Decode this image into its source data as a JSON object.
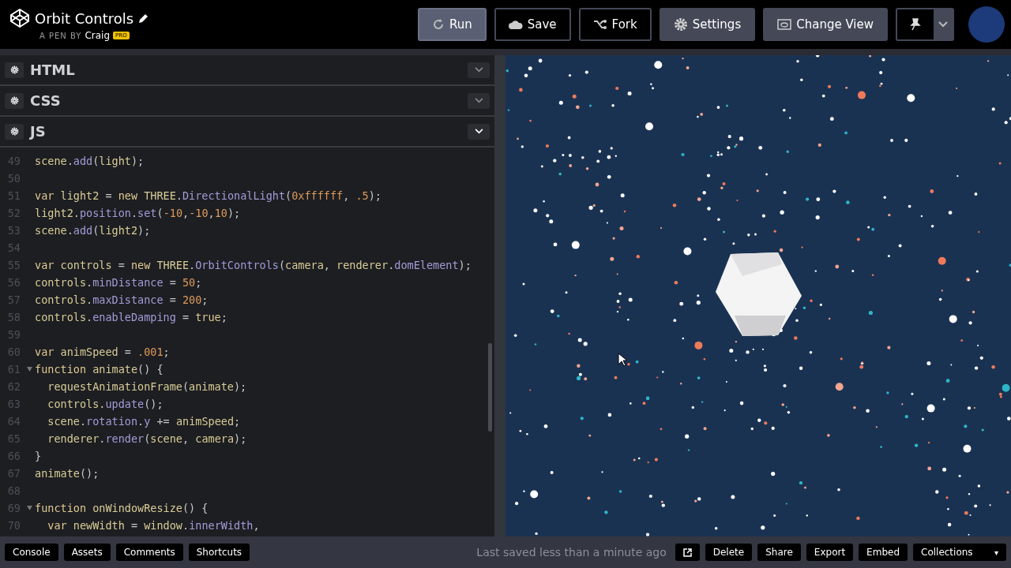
{
  "header": {
    "title": "Orbit Controls",
    "byline": "A PEN BY",
    "author": "Craig",
    "badge": "PRO",
    "buttons": [
      {
        "label": "Run",
        "kind": "run"
      },
      {
        "label": "Save",
        "kind": "save"
      },
      {
        "label": "Fork",
        "kind": "fork"
      },
      {
        "label": "Settings",
        "kind": "settings"
      },
      {
        "label": "Change View",
        "kind": "view"
      }
    ]
  },
  "panels": [
    {
      "label": "HTML",
      "expanded": false
    },
    {
      "label": "CSS",
      "expanded": false
    },
    {
      "label": "JS",
      "expanded": true
    }
  ],
  "code": [
    {
      "n": "49",
      "fold": false,
      "tokens": [
        {
          "kind": "ident",
          "text": "scene"
        },
        {
          "kind": "punct",
          "text": "."
        },
        {
          "kind": "member",
          "text": "add"
        },
        {
          "kind": "punct",
          "text": "("
        },
        {
          "kind": "ident",
          "text": "light"
        },
        {
          "kind": "punct",
          "text": ");"
        }
      ]
    },
    {
      "n": "50",
      "fold": false
    },
    {
      "n": "51",
      "fold": false,
      "tokens": [
        {
          "kind": "keyword",
          "text": "var "
        },
        {
          "kind": "ident",
          "text": "light2"
        },
        {
          "kind": "punct",
          "text": " = "
        },
        {
          "kind": "keyword",
          "text": "new "
        },
        {
          "kind": "ident",
          "text": "THREE"
        },
        {
          "kind": "punct",
          "text": "."
        },
        {
          "kind": "member",
          "text": "DirectionalLight"
        },
        {
          "kind": "punct",
          "text": "("
        },
        {
          "kind": "number",
          "text": "0xffffff"
        },
        {
          "kind": "punct",
          "text": ", "
        },
        {
          "kind": "number",
          "text": ".5"
        },
        {
          "kind": "punct",
          "text": ");"
        }
      ]
    },
    {
      "n": "52",
      "fold": false,
      "tokens": [
        {
          "kind": "ident",
          "text": "light2"
        },
        {
          "kind": "punct",
          "text": "."
        },
        {
          "kind": "member",
          "text": "position"
        },
        {
          "kind": "punct",
          "text": "."
        },
        {
          "kind": "member",
          "text": "set"
        },
        {
          "kind": "punct",
          "text": "("
        },
        {
          "kind": "number",
          "text": "-10"
        },
        {
          "kind": "punct",
          "text": ","
        },
        {
          "kind": "number",
          "text": "-10"
        },
        {
          "kind": "punct",
          "text": ","
        },
        {
          "kind": "number",
          "text": "10"
        },
        {
          "kind": "punct",
          "text": ");"
        }
      ]
    },
    {
      "n": "53",
      "fold": false,
      "tokens": [
        {
          "kind": "ident",
          "text": "scene"
        },
        {
          "kind": "punct",
          "text": "."
        },
        {
          "kind": "member",
          "text": "add"
        },
        {
          "kind": "punct",
          "text": "("
        },
        {
          "kind": "ident",
          "text": "light2"
        },
        {
          "kind": "punct",
          "text": ");"
        }
      ]
    },
    {
      "n": "54",
      "fold": false
    },
    {
      "n": "55",
      "fold": false,
      "tokens": [
        {
          "kind": "keyword",
          "text": "var "
        },
        {
          "kind": "ident",
          "text": "controls"
        },
        {
          "kind": "punct",
          "text": " = "
        },
        {
          "kind": "keyword",
          "text": "new "
        },
        {
          "kind": "ident",
          "text": "THREE"
        },
        {
          "kind": "punct",
          "text": "."
        },
        {
          "kind": "member",
          "text": "OrbitControls"
        },
        {
          "kind": "punct",
          "text": "("
        },
        {
          "kind": "ident",
          "text": "camera"
        },
        {
          "kind": "punct",
          "text": ", "
        },
        {
          "kind": "ident",
          "text": "renderer"
        },
        {
          "kind": "punct",
          "text": "."
        },
        {
          "kind": "member",
          "text": "domElement"
        },
        {
          "kind": "punct",
          "text": ");"
        }
      ]
    },
    {
      "n": "56",
      "fold": false,
      "tokens": [
        {
          "kind": "ident",
          "text": "controls"
        },
        {
          "kind": "punct",
          "text": "."
        },
        {
          "kind": "member",
          "text": "minDistance"
        },
        {
          "kind": "punct",
          "text": " = "
        },
        {
          "kind": "number",
          "text": "50"
        },
        {
          "kind": "punct",
          "text": ";"
        }
      ]
    },
    {
      "n": "57",
      "fold": false,
      "tokens": [
        {
          "kind": "ident",
          "text": "controls"
        },
        {
          "kind": "punct",
          "text": "."
        },
        {
          "kind": "member",
          "text": "maxDistance"
        },
        {
          "kind": "punct",
          "text": " = "
        },
        {
          "kind": "number",
          "text": "200"
        },
        {
          "kind": "punct",
          "text": ";"
        }
      ]
    },
    {
      "n": "58",
      "fold": false,
      "tokens": [
        {
          "kind": "ident",
          "text": "controls"
        },
        {
          "kind": "punct",
          "text": "."
        },
        {
          "kind": "member",
          "text": "enableDamping"
        },
        {
          "kind": "punct",
          "text": " = "
        },
        {
          "kind": "keyword",
          "text": "true"
        },
        {
          "kind": "punct",
          "text": ";"
        }
      ]
    },
    {
      "n": "59",
      "fold": false
    },
    {
      "n": "60",
      "fold": false,
      "tokens": [
        {
          "kind": "keyword",
          "text": "var "
        },
        {
          "kind": "ident",
          "text": "animSpeed"
        },
        {
          "kind": "punct",
          "text": " = "
        },
        {
          "kind": "number",
          "text": ".001"
        },
        {
          "kind": "punct",
          "text": ";"
        }
      ]
    },
    {
      "n": "61",
      "fold": true,
      "tokens": [
        {
          "kind": "keyword",
          "text": "function "
        },
        {
          "kind": "ident",
          "text": "animate"
        },
        {
          "kind": "punct",
          "text": "() {"
        }
      ]
    },
    {
      "n": "62",
      "fold": false,
      "tokens": [
        {
          "kind": "ident",
          "text": "  requestAnimationFrame"
        },
        {
          "kind": "punct",
          "text": "("
        },
        {
          "kind": "ident",
          "text": "animate"
        },
        {
          "kind": "punct",
          "text": ");"
        }
      ]
    },
    {
      "n": "63",
      "fold": false,
      "tokens": [
        {
          "kind": "ident",
          "text": "  controls."
        },
        {
          "kind": "member",
          "text": "update"
        },
        {
          "kind": "punct",
          "text": "();"
        }
      ]
    },
    {
      "n": "64",
      "fold": false,
      "tokens": [
        {
          "kind": "ident",
          "text": "  scene"
        },
        {
          "kind": "punct",
          "text": "."
        },
        {
          "kind": "member",
          "text": "rotation"
        },
        {
          "kind": "punct",
          "text": "."
        },
        {
          "kind": "member",
          "text": "y"
        },
        {
          "kind": "punct",
          "text": " += "
        },
        {
          "kind": "ident",
          "text": "animSpeed"
        },
        {
          "kind": "punct",
          "text": ";"
        }
      ]
    },
    {
      "n": "65",
      "fold": false,
      "tokens": [
        {
          "kind": "ident",
          "text": "  renderer"
        },
        {
          "kind": "punct",
          "text": "."
        },
        {
          "kind": "member",
          "text": "render"
        },
        {
          "kind": "punct",
          "text": "("
        },
        {
          "kind": "ident",
          "text": "scene"
        },
        {
          "kind": "punct",
          "text": ", "
        },
        {
          "kind": "ident",
          "text": "camera"
        },
        {
          "kind": "punct",
          "text": ");"
        }
      ]
    },
    {
      "n": "66",
      "fold": false,
      "tokens": [
        {
          "kind": "punct",
          "text": "}"
        }
      ]
    },
    {
      "n": "67",
      "fold": false,
      "tokens": [
        {
          "kind": "ident",
          "text": "animate"
        },
        {
          "kind": "punct",
          "text": "();"
        }
      ]
    },
    {
      "n": "68",
      "fold": false
    },
    {
      "n": "69",
      "fold": true,
      "tokens": [
        {
          "kind": "keyword",
          "text": "function "
        },
        {
          "kind": "ident",
          "text": "onWindowResize"
        },
        {
          "kind": "punct",
          "text": "() {"
        }
      ]
    },
    {
      "n": "70",
      "fold": false,
      "tokens": [
        {
          "kind": "keyword",
          "text": "  var "
        },
        {
          "kind": "ident",
          "text": "newWidth"
        },
        {
          "kind": "punct",
          "text": " = "
        },
        {
          "kind": "ident",
          "text": "window"
        },
        {
          "kind": "punct",
          "text": "."
        },
        {
          "kind": "member",
          "text": "innerWidth"
        },
        {
          "kind": "punct",
          "text": ","
        }
      ]
    }
  ],
  "footer": {
    "left": [
      "Console",
      "Assets",
      "Comments",
      "Shortcuts"
    ],
    "status": "Last saved less than a minute ago",
    "right": [
      "Delete",
      "Share",
      "Export",
      "Embed"
    ],
    "collections": "Collections",
    "collections_caret": "▾"
  }
}
